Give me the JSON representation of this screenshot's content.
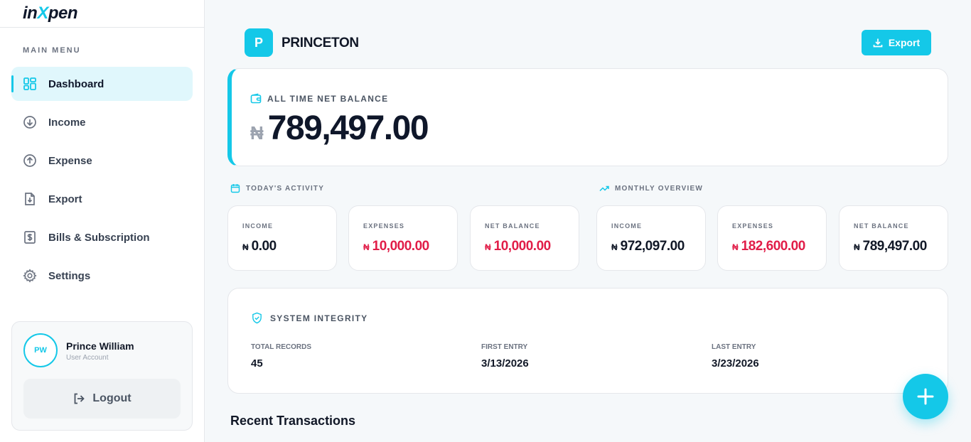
{
  "brand": {
    "logo_pre": "in",
    "logo_x": "X",
    "logo_post": "pen",
    "accent": "#14c8e8"
  },
  "sidebar": {
    "menu_title": "MAIN MENU",
    "items": [
      {
        "label": "Dashboard",
        "icon": "grid-icon",
        "active": true
      },
      {
        "label": "Income",
        "icon": "arrow-down-circle-icon"
      },
      {
        "label": "Expense",
        "icon": "arrow-up-circle-icon"
      },
      {
        "label": "Export",
        "icon": "file-download-icon"
      },
      {
        "label": "Bills & Subscription",
        "icon": "receipt-icon"
      },
      {
        "label": "Settings",
        "icon": "gear-icon"
      }
    ],
    "user": {
      "initials": "PW",
      "name": "Prince William",
      "role": "User Account",
      "logout_label": "Logout"
    }
  },
  "header": {
    "org_initial": "P",
    "org_name": "PRINCETON",
    "export_label": "Export"
  },
  "balance": {
    "label": "ALL TIME NET BALANCE",
    "currency": "₦",
    "amount": "789,497.00"
  },
  "today": {
    "title": "TODAY'S ACTIVITY",
    "income": {
      "label": "INCOME",
      "currency": "₦",
      "value": "0.00"
    },
    "expenses": {
      "label": "EXPENSES",
      "currency": "₦",
      "value": "10,000.00"
    },
    "net": {
      "label": "NET BALANCE",
      "currency": "₦",
      "value": "10,000.00"
    }
  },
  "monthly": {
    "title": "MONTHLY OVERVIEW",
    "income": {
      "label": "INCOME",
      "currency": "₦",
      "value": "972,097.00"
    },
    "expenses": {
      "label": "EXPENSES",
      "currency": "₦",
      "value": "182,600.00"
    },
    "net": {
      "label": "NET BALANCE",
      "currency": "₦",
      "value": "789,497.00"
    }
  },
  "integrity": {
    "title": "SYSTEM INTEGRITY",
    "total_records": {
      "label": "TOTAL RECORDS",
      "value": "45"
    },
    "first_entry": {
      "label": "FIRST ENTRY",
      "value": "3/13/2026"
    },
    "last_entry": {
      "label": "LAST ENTRY",
      "value": "3/23/2026"
    }
  },
  "recent": {
    "title": "Recent Transactions"
  }
}
